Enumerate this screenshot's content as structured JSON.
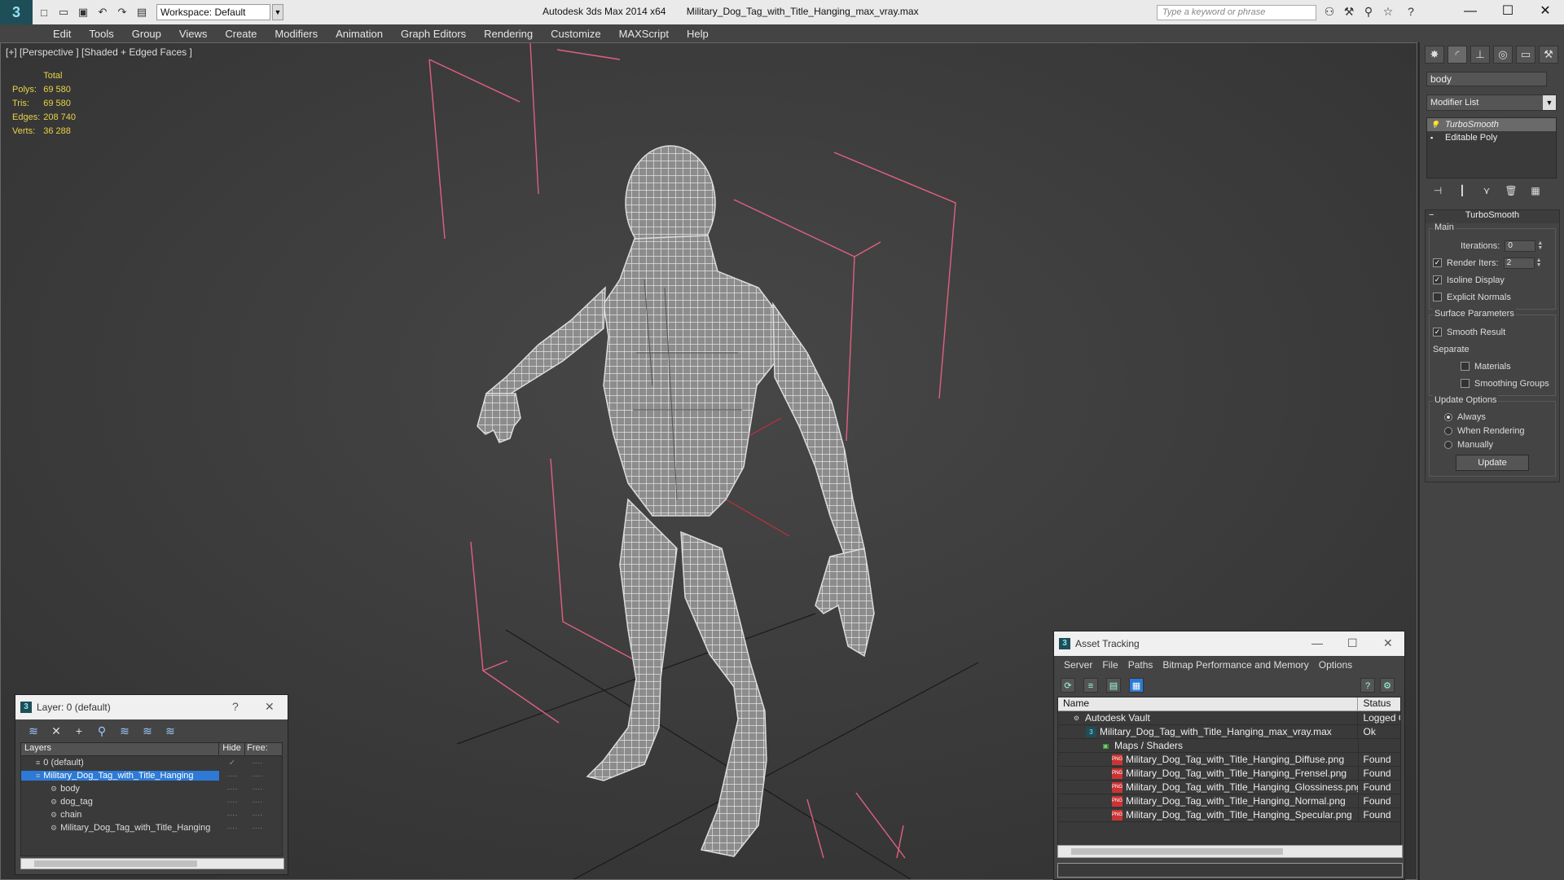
{
  "titlebar": {
    "workspace_label": "Workspace: Default",
    "app_title": "Autodesk 3ds Max  2014 x64",
    "file_title": "Military_Dog_Tag_with_Title_Hanging_max_vray.max",
    "search_placeholder": "Type a keyword or phrase"
  },
  "menu": [
    "Edit",
    "Tools",
    "Group",
    "Views",
    "Create",
    "Modifiers",
    "Animation",
    "Graph Editors",
    "Rendering",
    "Customize",
    "MAXScript",
    "Help"
  ],
  "viewport": {
    "label": "[+] [Perspective ] [Shaded + Edged Faces ]",
    "stats": {
      "header": "Total",
      "rows": [
        {
          "label": "Polys:",
          "value": "69 580"
        },
        {
          "label": "Tris:",
          "value": "69 580"
        },
        {
          "label": "Edges:",
          "value": "208 740"
        },
        {
          "label": "Verts:",
          "value": "36 288"
        }
      ]
    }
  },
  "command_panel": {
    "object_name": "body",
    "modifier_list": "Modifier List",
    "stack": [
      {
        "label": "TurboSmooth",
        "selected": true
      },
      {
        "label": "Editable Poly",
        "selected": false
      }
    ],
    "rollout_title": "TurboSmooth",
    "main_group": "Main",
    "iterations_label": "Iterations:",
    "iterations_value": "0",
    "render_iters_label": "Render Iters:",
    "render_iters_value": "2",
    "isoline_label": "Isoline Display",
    "explicit_normals_label": "Explicit Normals",
    "surface_group": "Surface Parameters",
    "smooth_result_label": "Smooth Result",
    "separate_label": "Separate",
    "materials_label": "Materials",
    "smoothing_groups_label": "Smoothing Groups",
    "update_group": "Update Options",
    "always_label": "Always",
    "when_rendering_label": "When Rendering",
    "manually_label": "Manually",
    "update_button": "Update"
  },
  "layer_dialog": {
    "title": "Layer: 0 (default)",
    "col_layers": "Layers",
    "col_hide": "Hide",
    "col_freeze": "Free:",
    "rows": [
      {
        "name": "0 (default)",
        "level": "top"
      },
      {
        "name": "Military_Dog_Tag_with_Title_Hanging",
        "level": "top",
        "selected": true
      },
      {
        "name": "body",
        "level": "child"
      },
      {
        "name": "dog_tag",
        "level": "child"
      },
      {
        "name": "chain",
        "level": "child"
      },
      {
        "name": "Military_Dog_Tag_with_Title_Hanging",
        "level": "child"
      }
    ]
  },
  "asset_dialog": {
    "title": "Asset Tracking",
    "menu": [
      "Server",
      "File",
      "Paths",
      "Bitmap Performance and Memory",
      "Options"
    ],
    "col_name": "Name",
    "col_status": "Status",
    "rows": [
      {
        "name": "Autodesk Vault",
        "status": "Logged O",
        "icon": "vault",
        "indent": 16
      },
      {
        "name": "Military_Dog_Tag_with_Title_Hanging_max_vray.max",
        "status": "Ok",
        "icon": "max",
        "indent": 34
      },
      {
        "name": "Maps / Shaders",
        "status": "",
        "icon": "maps",
        "indent": 52
      },
      {
        "name": "Military_Dog_Tag_with_Title_Hanging_Diffuse.png",
        "status": "Found",
        "icon": "png",
        "indent": 66
      },
      {
        "name": "Military_Dog_Tag_with_Title_Hanging_Frensel.png",
        "status": "Found",
        "icon": "png",
        "indent": 66
      },
      {
        "name": "Military_Dog_Tag_with_Title_Hanging_Glossiness.png",
        "status": "Found",
        "icon": "png",
        "indent": 66
      },
      {
        "name": "Military_Dog_Tag_with_Title_Hanging_Normal.png",
        "status": "Found",
        "icon": "png",
        "indent": 66
      },
      {
        "name": "Military_Dog_Tag_with_Title_Hanging_Specular.png",
        "status": "Found",
        "icon": "png",
        "indent": 66
      }
    ]
  }
}
